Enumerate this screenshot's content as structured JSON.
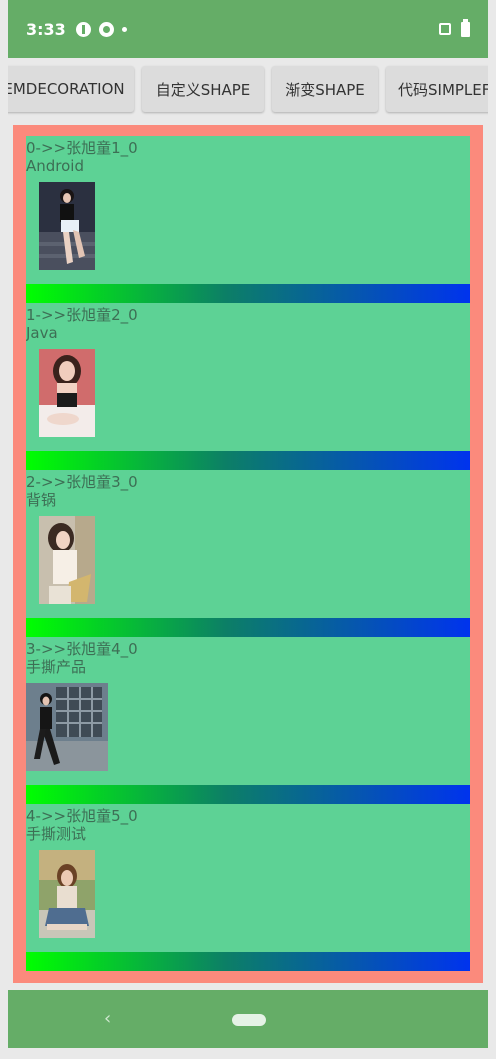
{
  "status_bar": {
    "time": "3:33",
    "icons": [
      "p-circle-icon",
      "q-circle-icon",
      "dot-icon",
      "vibrate-icon",
      "battery-icon"
    ],
    "color": "#65ad67"
  },
  "toolbar": {
    "buttons": [
      {
        "label": "EMDECORATION"
      },
      {
        "label": "自定义SHAPE"
      },
      {
        "label": "渐变SHAPE"
      },
      {
        "label": "代码SIMPLEF"
      }
    ]
  },
  "list": {
    "frame_color": "#fb8a7c",
    "item_bg": "#5dd295",
    "divider_gradient": [
      "#00ff00",
      "#0c7f66",
      "#0033ee"
    ],
    "items": [
      {
        "title": "0->>张旭童1_0",
        "subtitle": "Android",
        "image": "photo-portrait"
      },
      {
        "title": "1->>张旭童2_0",
        "subtitle": "Java",
        "image": "photo-portrait"
      },
      {
        "title": "2->>张旭童3_0",
        "subtitle": "背锅",
        "image": "photo-portrait"
      },
      {
        "title": "3->>张旭童4_0",
        "subtitle": "手撕产品",
        "image": "photo-landscape"
      },
      {
        "title": "4->>张旭童5_0",
        "subtitle": "手撕测试",
        "image": "photo-portrait"
      }
    ]
  },
  "nav_bar": {
    "icons": [
      "back-icon",
      "home-pill-icon"
    ]
  }
}
